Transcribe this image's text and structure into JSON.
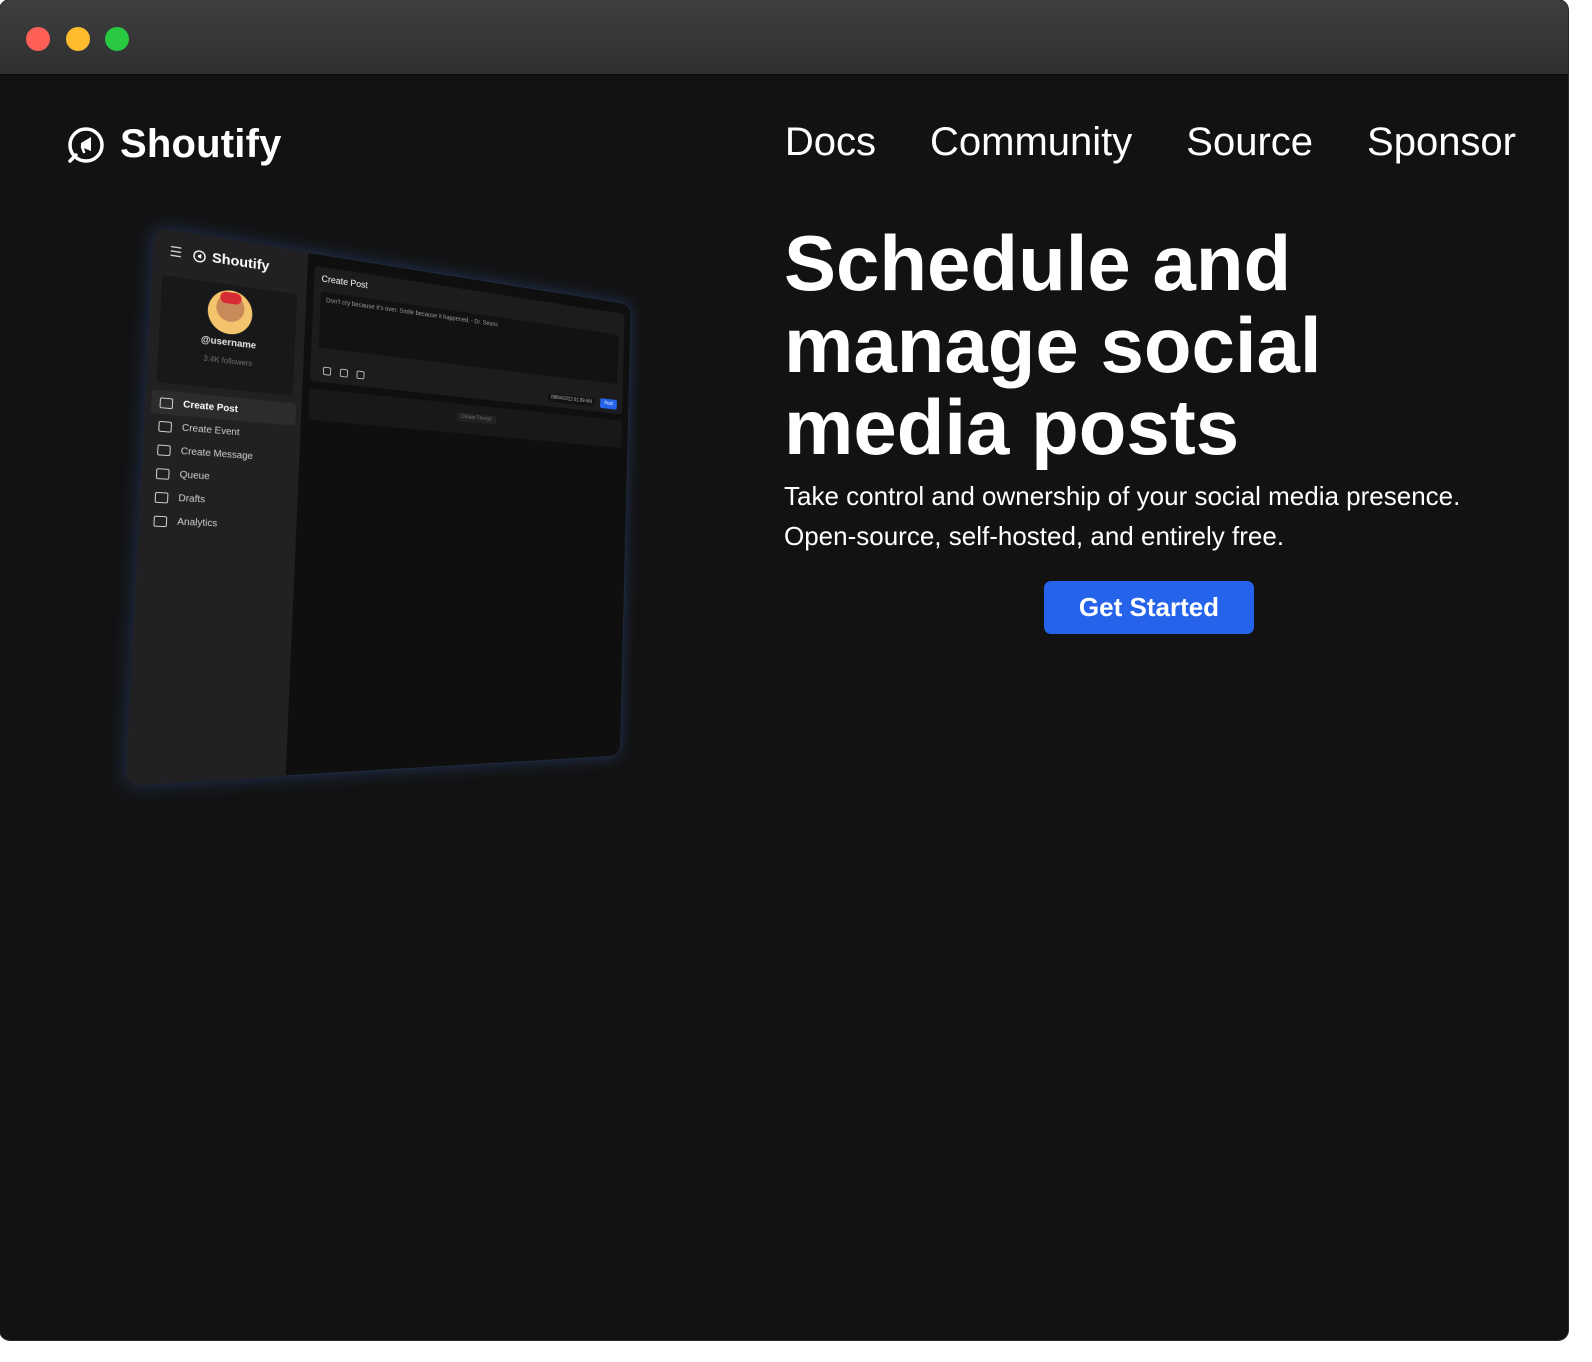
{
  "window": {
    "controls": [
      "close",
      "minimize",
      "maximize"
    ]
  },
  "nav": {
    "brand": "Shoutify",
    "links": [
      "Docs",
      "Community",
      "Source",
      "Sponsor"
    ]
  },
  "hero": {
    "title": "Schedule and manage social media posts",
    "subtitle_line1": "Take control and ownership of your social media presence.",
    "subtitle_line2": "Open-source, self-hosted, and entirely free.",
    "cta": "Get Started"
  },
  "preview": {
    "brand": "Shoutify",
    "username": "@username",
    "followers": "3.4K followers",
    "menu": [
      "Create Post",
      "Create Event",
      "Create Message",
      "Queue",
      "Drafts",
      "Analytics"
    ],
    "card_title": "Create Post",
    "post_text": "Don't cry because it's over. Smile because it happened. - Dr. Seuss",
    "date": "09/04/2022 01:09 AM",
    "post_button": "Post",
    "thread_button": "Create Thread"
  },
  "colors": {
    "accent": "#2563eb",
    "background": "#121213"
  }
}
